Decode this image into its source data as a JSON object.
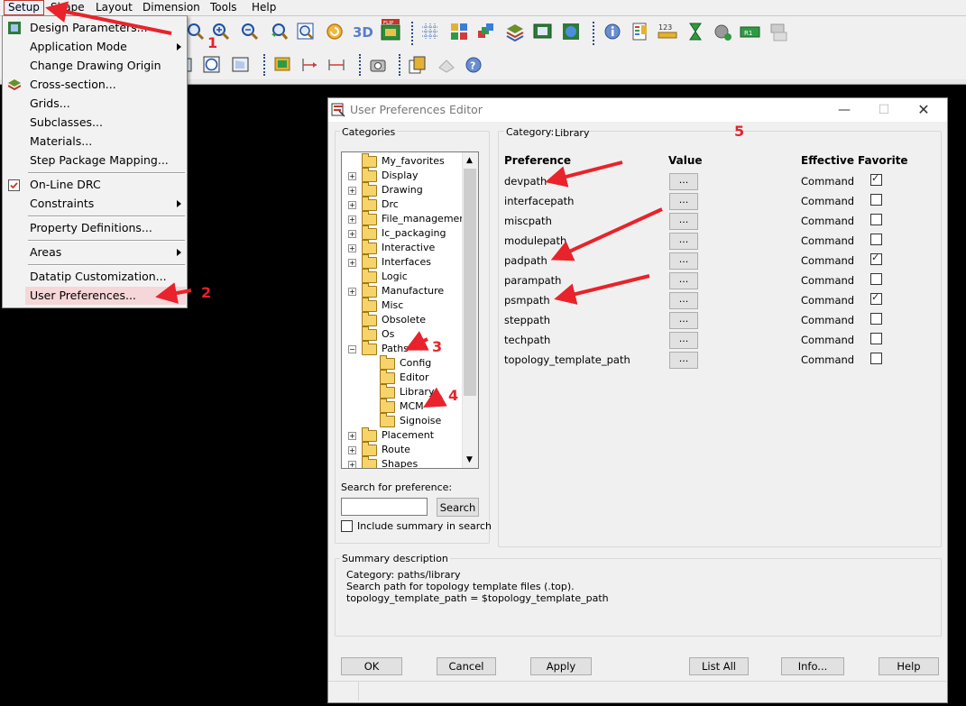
{
  "menubar": {
    "items": [
      "Setup",
      "Shape",
      "Layout",
      "Dimension",
      "Tools",
      "Help"
    ]
  },
  "setup_menu": {
    "items": [
      {
        "label": "Design Parameters...",
        "submenu": false
      },
      {
        "label": "Application Mode",
        "submenu": true
      },
      {
        "label": "Change Drawing Origin",
        "submenu": false
      },
      {
        "label": "Cross-section...",
        "submenu": false
      },
      {
        "label": "Grids...",
        "submenu": false
      },
      {
        "label": "Subclasses...",
        "submenu": false
      },
      {
        "label": "Materials...",
        "submenu": false
      },
      {
        "label": "Step Package Mapping...",
        "submenu": false
      },
      {
        "label": "On-Line DRC",
        "submenu": false,
        "checked": true
      },
      {
        "label": "Constraints",
        "submenu": true
      },
      {
        "label": "Property Definitions...",
        "submenu": false
      },
      {
        "label": "Areas",
        "submenu": true
      },
      {
        "label": "Datatip Customization...",
        "submenu": false
      },
      {
        "label": "User Preferences...",
        "submenu": false,
        "highlighted": true
      }
    ]
  },
  "dialog": {
    "title": "User Preferences Editor",
    "categories_label": "Categories",
    "category_label": "Category:",
    "category_value": "Library",
    "tree": [
      {
        "label": "My_favorites",
        "expander": ""
      },
      {
        "label": "Display",
        "expander": "+"
      },
      {
        "label": "Drawing",
        "expander": "+"
      },
      {
        "label": "Drc",
        "expander": "+"
      },
      {
        "label": "File_management",
        "expander": "+"
      },
      {
        "label": "Ic_packaging",
        "expander": "+"
      },
      {
        "label": "Interactive",
        "expander": "+"
      },
      {
        "label": "Interfaces",
        "expander": "+"
      },
      {
        "label": "Logic",
        "expander": ""
      },
      {
        "label": "Manufacture",
        "expander": "+"
      },
      {
        "label": "Misc",
        "expander": ""
      },
      {
        "label": "Obsolete",
        "expander": ""
      },
      {
        "label": "Os",
        "expander": ""
      },
      {
        "label": "Paths",
        "expander": "-"
      },
      {
        "label": "Config",
        "expander": "child"
      },
      {
        "label": "Editor",
        "expander": "child"
      },
      {
        "label": "Library",
        "expander": "child"
      },
      {
        "label": "MCM",
        "expander": "child"
      },
      {
        "label": "Signoise",
        "expander": "child"
      },
      {
        "label": "Placement",
        "expander": "+"
      },
      {
        "label": "Route",
        "expander": "+"
      },
      {
        "label": "Shapes",
        "expander": "+"
      }
    ],
    "search_label": "Search for preference:",
    "search_value": "",
    "search_button": "Search",
    "include_summary": "Include summary in search",
    "columns": {
      "preference": "Preference",
      "value": "Value",
      "effective": "Effective",
      "favorite": "Favorite"
    },
    "rows": [
      {
        "preference": "devpath",
        "value": "...",
        "effective": "Command",
        "favorite": true
      },
      {
        "preference": "interfacepath",
        "value": "...",
        "effective": "Command",
        "favorite": false
      },
      {
        "preference": "miscpath",
        "value": "...",
        "effective": "Command",
        "favorite": false
      },
      {
        "preference": "modulepath",
        "value": "...",
        "effective": "Command",
        "favorite": false
      },
      {
        "preference": "padpath",
        "value": "...",
        "effective": "Command",
        "favorite": true
      },
      {
        "preference": "parampath",
        "value": "...",
        "effective": "Command",
        "favorite": false
      },
      {
        "preference": "psmpath",
        "value": "...",
        "effective": "Command",
        "favorite": true
      },
      {
        "preference": "steppath",
        "value": "...",
        "effective": "Command",
        "favorite": false
      },
      {
        "preference": "techpath",
        "value": "...",
        "effective": "Command",
        "favorite": false
      },
      {
        "preference": "topology_template_path",
        "value": "...",
        "effective": "Command",
        "favorite": false
      }
    ],
    "summary": {
      "label": "Summary description",
      "lines": [
        "Category: paths/library",
        "Search path for topology template files (.top).",
        "topology_template_path = $topology_template_path"
      ]
    },
    "buttons": {
      "ok": "OK",
      "cancel": "Cancel",
      "apply": "Apply",
      "list_all": "List All",
      "info": "Info...",
      "help": "Help"
    }
  },
  "annotations": [
    "1",
    "2",
    "3",
    "4",
    "5"
  ],
  "colors": {
    "annotation": "#e8232b",
    "menu_highlight": "#f6d6d8"
  }
}
